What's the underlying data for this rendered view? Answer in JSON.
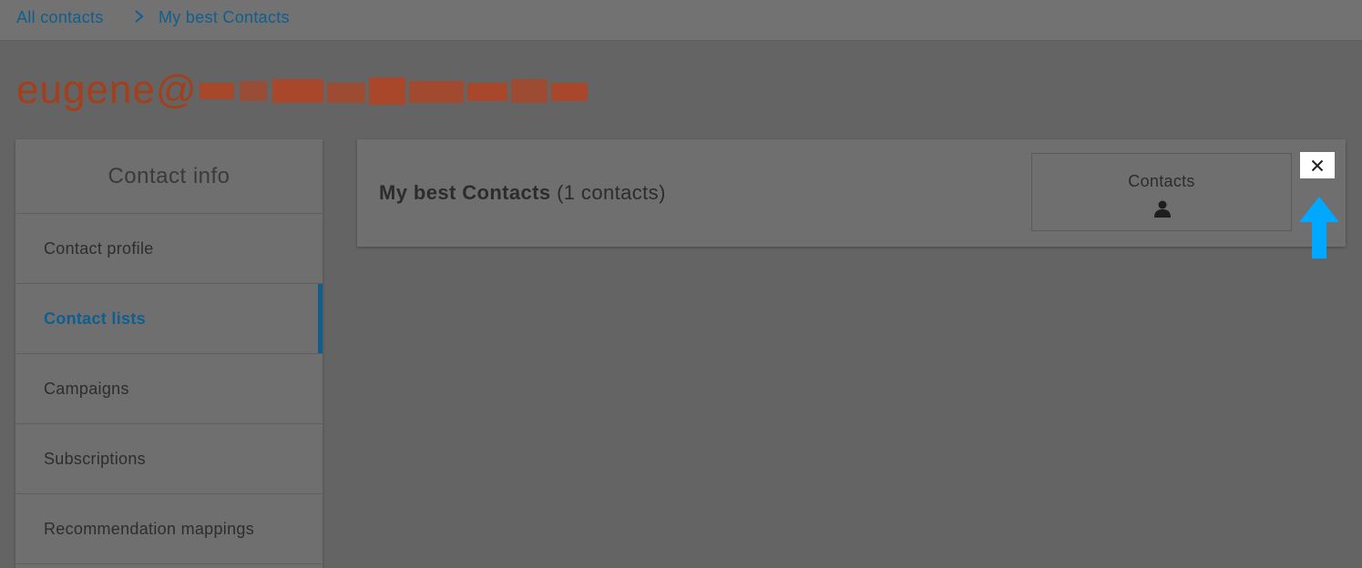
{
  "breadcrumb": {
    "items": [
      {
        "label": "All contacts"
      },
      {
        "label": "My best Contacts"
      }
    ]
  },
  "contact": {
    "email_visible": "eugene@"
  },
  "sidebar": {
    "header": "Contact info",
    "items": [
      {
        "label": "Contact profile"
      },
      {
        "label": "Contact lists"
      },
      {
        "label": "Campaigns"
      },
      {
        "label": "Subscriptions"
      },
      {
        "label": "Recommendation mappings"
      }
    ],
    "active_index": 1
  },
  "list_card": {
    "name": "My best Contacts",
    "count_text": "(1 contacts)",
    "counter_label": "Contacts"
  },
  "colors": {
    "overlay_bg": "#646464",
    "link": "#0f5f8e",
    "email": "#a43f1b",
    "arrow": "#00a8ff"
  },
  "icons": {
    "breadcrumb_separator": "chevron-right-icon",
    "counter": "person-icon",
    "close": "close-icon",
    "annotation": "arrow-up-icon"
  }
}
